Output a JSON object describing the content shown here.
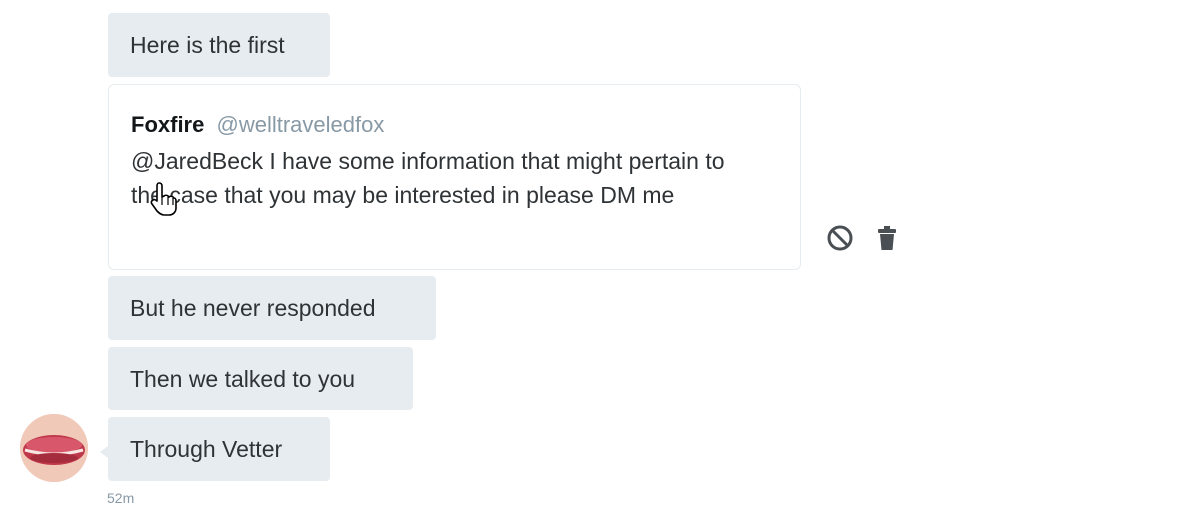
{
  "messages": [
    {
      "text": "Here is the first"
    },
    {
      "text": "But he never responded"
    },
    {
      "text": "Then we talked to you"
    },
    {
      "text": "Through Vetter"
    }
  ],
  "quoted_tweet": {
    "name": "Foxfire",
    "handle": "@welltraveledfox",
    "text": "@JaredBeck I have some information that might pertain to the case that you may be interested in please DM me"
  },
  "actions": {
    "report_icon": "block-icon",
    "delete_icon": "trash-icon"
  },
  "timestamp": "52m",
  "colors": {
    "bubble_background": "#e6ecf0",
    "text": "#2f3336",
    "muted": "#8899a6",
    "icon": "#4a4f54"
  }
}
